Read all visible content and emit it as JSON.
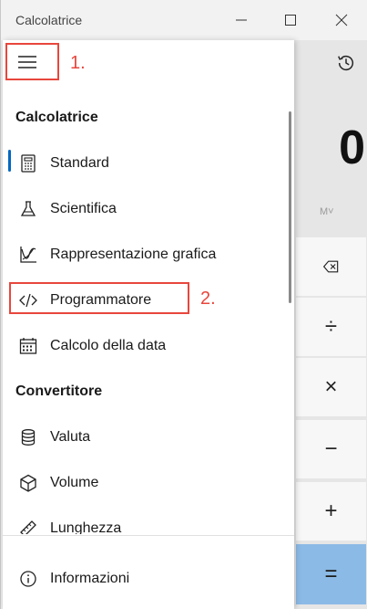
{
  "window": {
    "title": "Calcolatrice"
  },
  "drawer": {
    "sections": {
      "calculator_header": "Calcolatrice",
      "converter_header": "Convertitore"
    },
    "items": {
      "standard": "Standard",
      "scientific": "Scientifica",
      "graphing": "Rappresentazione grafica",
      "programmer": "Programmatore",
      "date": "Calcolo della data",
      "currency": "Valuta",
      "volume": "Volume",
      "length": "Lunghezza",
      "about": "Informazioni"
    },
    "selected_item": "Standard"
  },
  "annotations": {
    "step1": "1.",
    "step2": "2."
  },
  "calculator": {
    "display": "0",
    "memory": "M˅",
    "keys": {
      "backspace": "⌫",
      "divide": "÷",
      "multiply": "×",
      "subtract": "−",
      "add": "+",
      "equals": "="
    }
  },
  "colors": {
    "annotation": "#e8463c",
    "accent": "#0067c0",
    "equals_key": "#8cbae6"
  }
}
